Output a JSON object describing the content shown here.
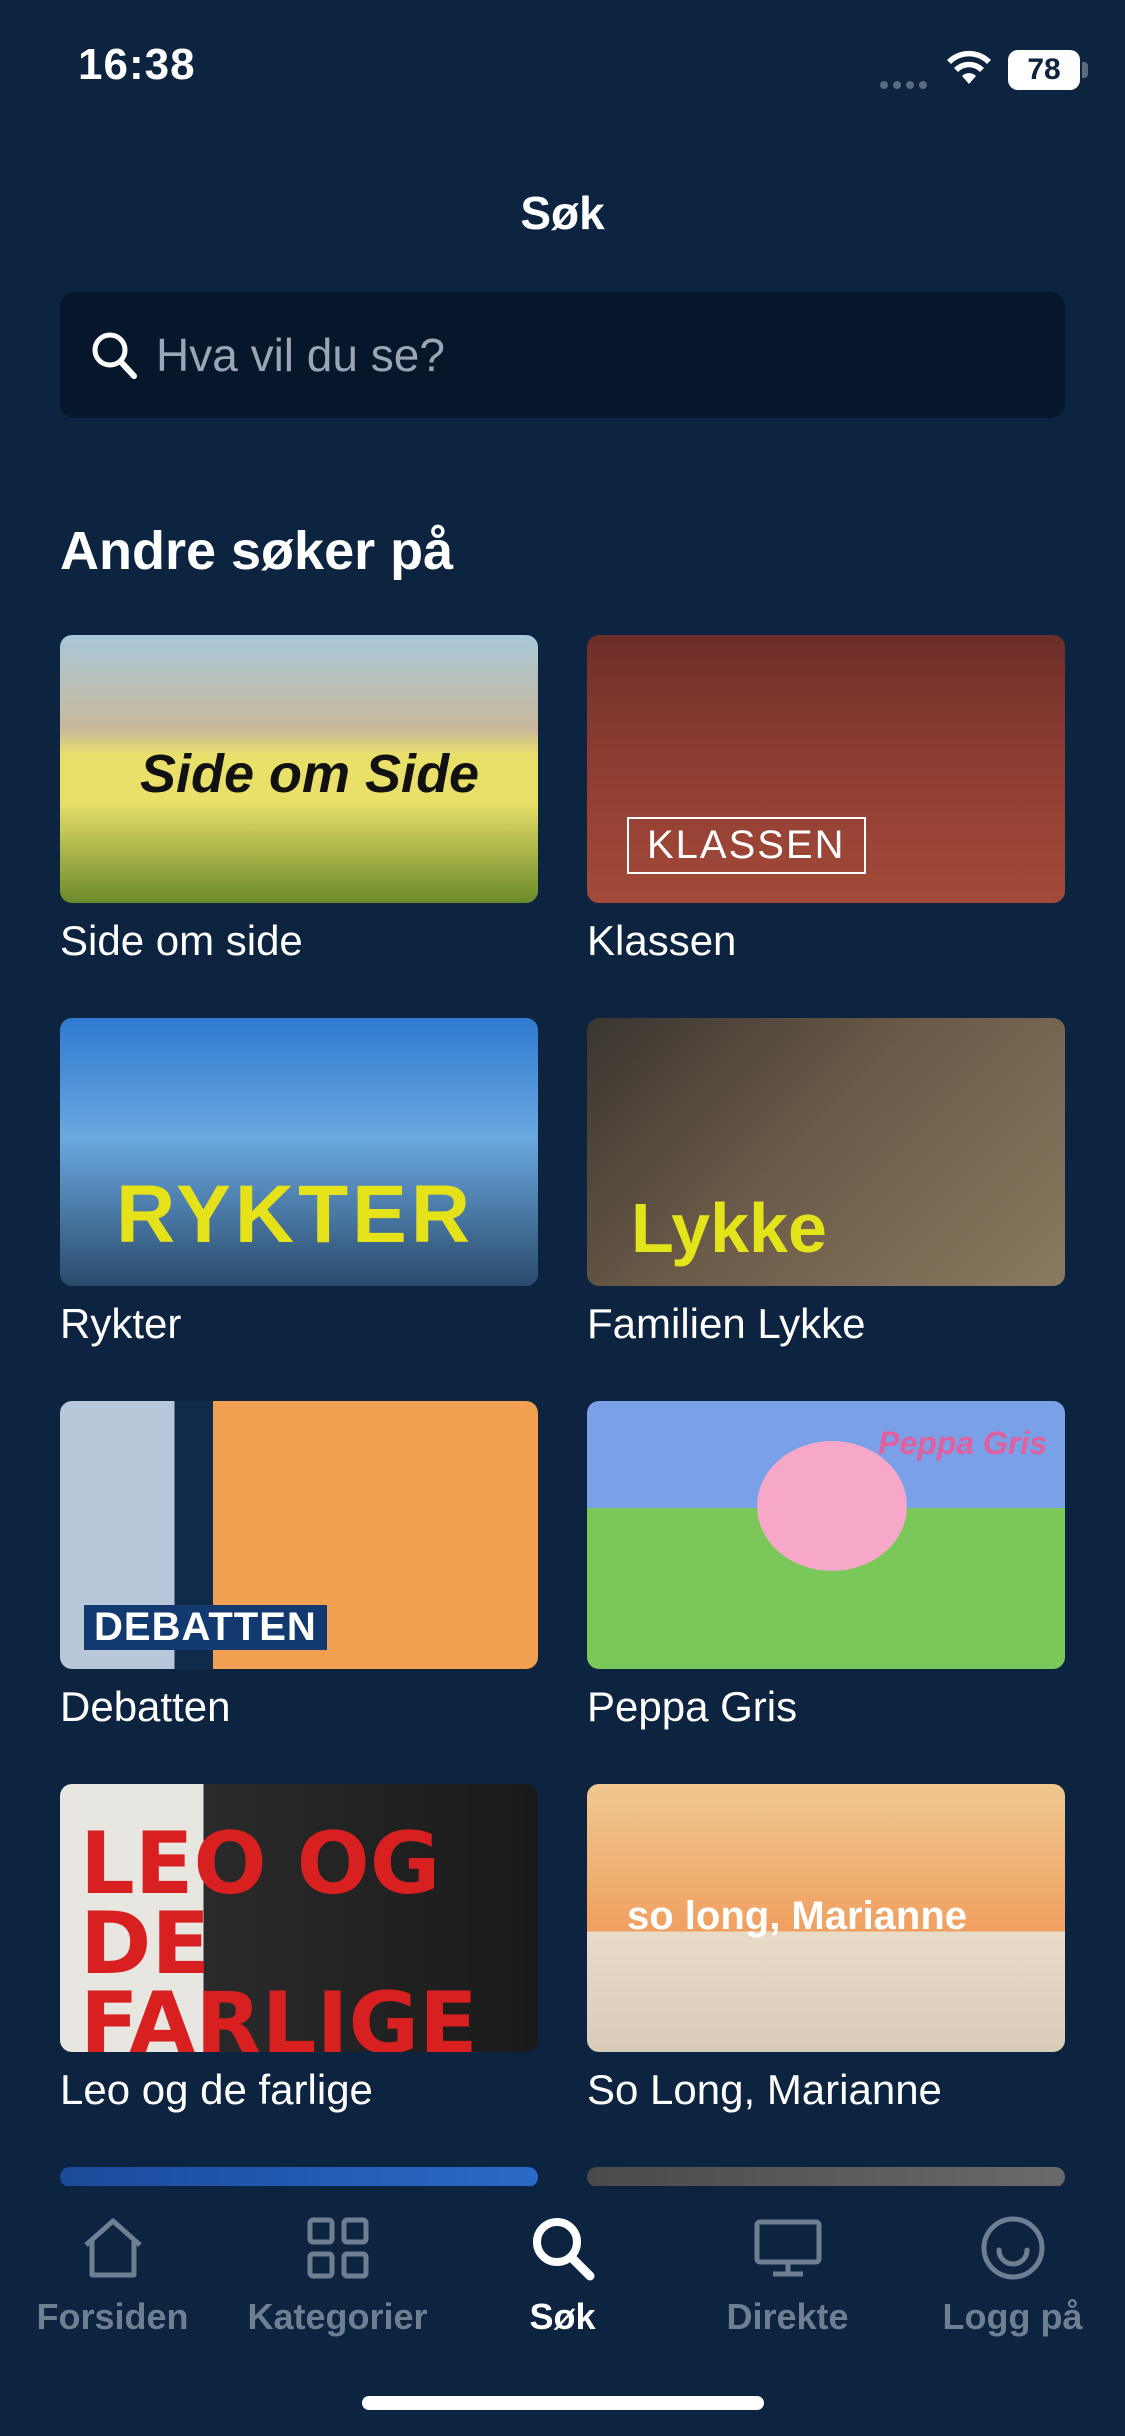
{
  "status_bar": {
    "time": "16:38",
    "battery": "78"
  },
  "header": {
    "title": "Søk"
  },
  "search": {
    "placeholder": "Hva vil du se?"
  },
  "section": {
    "title": "Andre søker på"
  },
  "items": [
    {
      "title": "Side om side",
      "art_text": "Side om Side"
    },
    {
      "title": "Klassen",
      "art_text": "KLASSEN"
    },
    {
      "title": "Rykter",
      "art_text": "RYKTER"
    },
    {
      "title": "Familien Lykke",
      "art_text": "Lykke"
    },
    {
      "title": "Debatten",
      "art_text": "DEBATTEN"
    },
    {
      "title": "Peppa Gris",
      "art_text": "Peppa Gris"
    },
    {
      "title": "Leo og de farlige",
      "art_text": "LEO OG DE FARLIGE"
    },
    {
      "title": "So Long, Marianne",
      "art_text": "so long, Marianne"
    }
  ],
  "tabs": [
    {
      "label": "Forsiden",
      "icon": "home-icon"
    },
    {
      "label": "Kategorier",
      "icon": "grid-icon"
    },
    {
      "label": "Søk",
      "icon": "search-icon",
      "active": true
    },
    {
      "label": "Direkte",
      "icon": "tv-icon"
    },
    {
      "label": "Logg på",
      "icon": "profile-icon"
    }
  ],
  "colors": {
    "background": "#0c2440",
    "search_bg": "#06172b",
    "inactive_tab": "#6f7f92"
  }
}
